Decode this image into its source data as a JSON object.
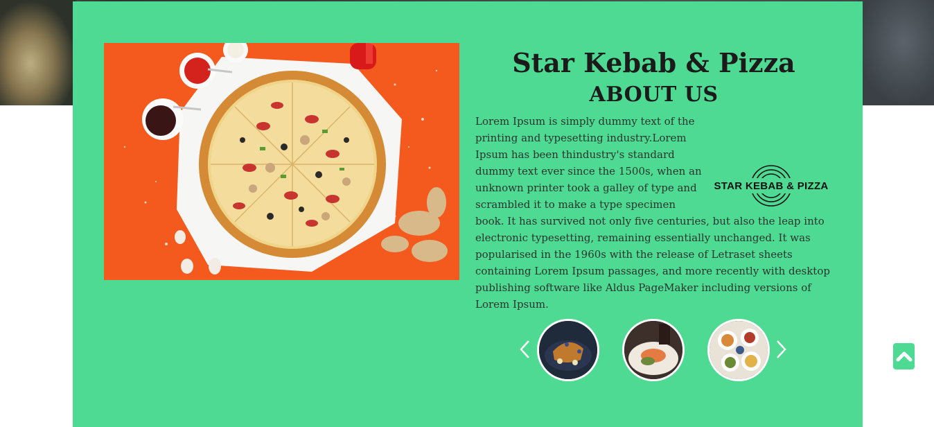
{
  "hero": {
    "background": "#3a403f"
  },
  "panel": {
    "background": "#4fda94"
  },
  "feature_image": {
    "subject": "pizza on white board with sauces and ginger on orange background"
  },
  "about": {
    "title": "Star Kebab & Pizza",
    "heading": "ABOUT US",
    "body": "Lorem Ipsum is simply dummy text of the printing and typesetting industry.Lorem Ipsum has been thindustry's standard dummy text ever since the 1500s, when an unknown printer took a galley of type and scrambled it to make a type specimen book. It has survived not only five centuries,  but also the leap into electronic typesetting, remaining essentially unchanged. It was popularised in the 1960s with the release of Letraset sheets containing Lorem Ipsum passages, and more recently with desktop publishing software like Aldus PageMaker including versions of Lorem Ipsum."
  },
  "logo": {
    "text": "STAR KEBAB & PIZZA"
  },
  "carousel": {
    "prev_icon": "chevron-left-icon",
    "next_icon": "chevron-right-icon",
    "thumbnails": [
      {
        "subject": "pastry with berries"
      },
      {
        "subject": "fish plate"
      },
      {
        "subject": "table of dishes"
      }
    ]
  },
  "scroll_top": {
    "icon": "chevron-up-icon",
    "color": "#4fda94"
  }
}
